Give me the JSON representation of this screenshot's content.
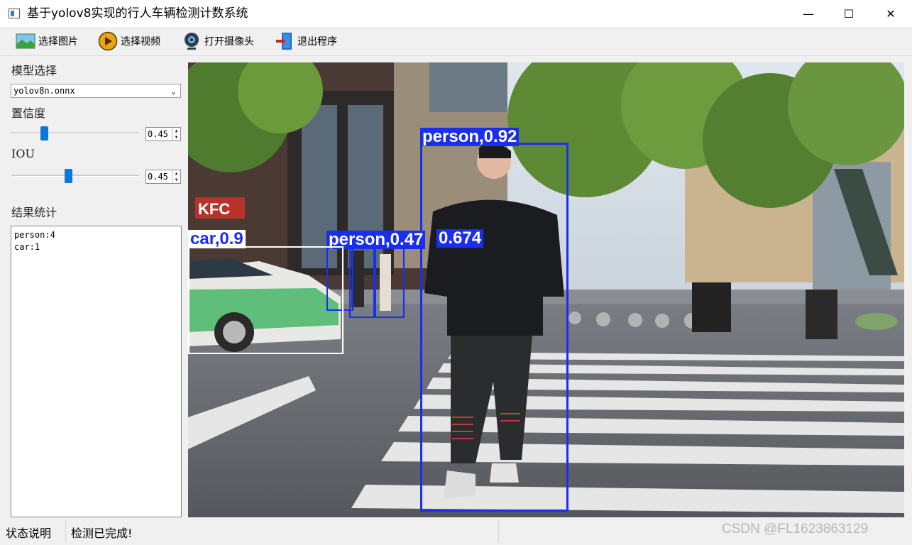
{
  "window": {
    "title": "基于yolov8实现的行人车辆检测计数系统",
    "controls": {
      "minimize": "—",
      "maximize": "☐",
      "close": "✕"
    }
  },
  "toolbar": {
    "items": [
      {
        "label": "选择图片",
        "icon": "image-icon"
      },
      {
        "label": "选择视频",
        "icon": "play-icon"
      },
      {
        "label": "打开摄像头",
        "icon": "webcam-icon"
      },
      {
        "label": "退出程序",
        "icon": "exit-door-icon"
      }
    ]
  },
  "left_panel": {
    "model_label": "模型选择",
    "model_value": "yolov8n.onnx",
    "confidence_label": "置信度",
    "confidence_value": "0.45",
    "confidence_level": 0.25,
    "iou_label": "IOU",
    "iou_value": "0.45",
    "iou_level": 0.45,
    "results_label": "结果统计",
    "results_lines": [
      "person:4",
      "car:1"
    ]
  },
  "detections": [
    {
      "label": "person,0.92",
      "color": "#1a2ef0"
    },
    {
      "label": "person,0.47",
      "color": "#1a2ef0"
    },
    {
      "label": "0.674",
      "color": "#1a2ef0"
    },
    {
      "label": "car,0.9",
      "color": "#ffffff"
    }
  ],
  "status": {
    "label": "状态说明",
    "message": "检测已完成!"
  },
  "watermark": "CSDN @FL1623863129"
}
